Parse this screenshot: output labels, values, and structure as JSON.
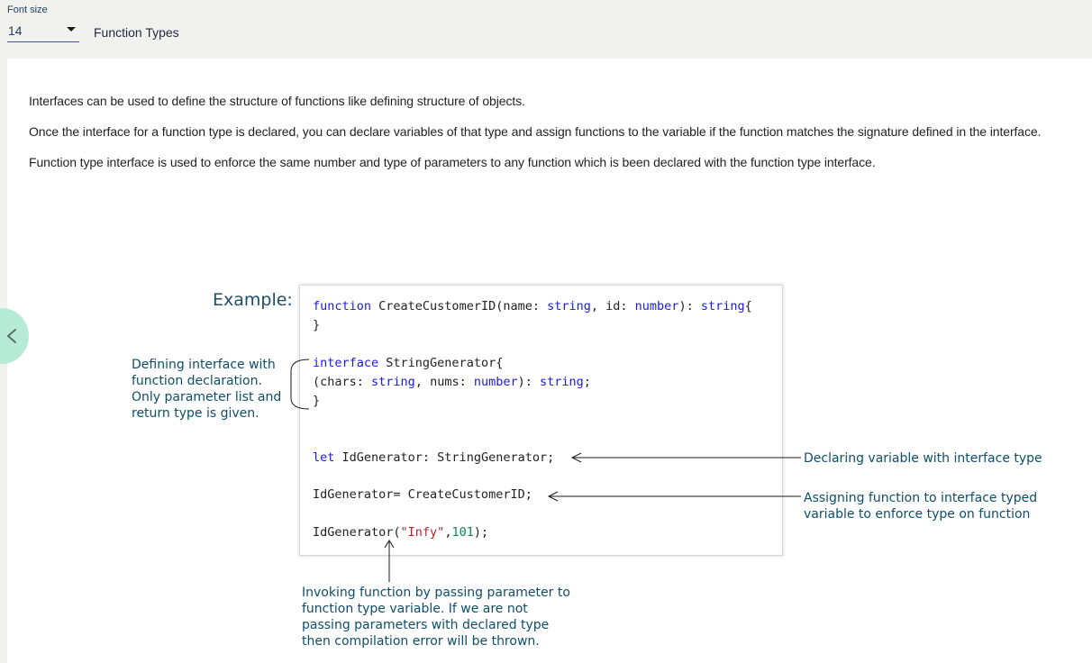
{
  "toolbar": {
    "font_size_label": "Font size",
    "font_size_value": "14",
    "title": "Function Types"
  },
  "content": {
    "paragraphs": [
      "Interfaces can be used to define the structure of functions like defining structure of objects.",
      "Once the interface for a function type is declared, you can declare variables of that type and assign functions to the variable if the function matches the signature defined in the interface.",
      "Function type interface is used to enforce the same number and type of parameters to any function which is been declared with the function type interface."
    ]
  },
  "figure": {
    "example_label": "Example:",
    "code": {
      "l1": {
        "kw1": "function",
        "t1": " CreateCustomerID(name: ",
        "kw2": "string",
        "t2": ", id: ",
        "kw3": "number",
        "t3": "): ",
        "kw4": "string",
        "t4": "{"
      },
      "l2": "}",
      "l3": {
        "kw1": "interface",
        "t1": " StringGenerator{"
      },
      "l4": {
        "t0": "(chars: ",
        "kw1": "string",
        "t1": ", nums: ",
        "kw2": "number",
        "t2": "): ",
        "kw3": "string",
        "t3": ";"
      },
      "l5": "}",
      "l6": {
        "kw1": "let",
        "t1": " IdGenerator: StringGenerator;"
      },
      "l7": "IdGenerator= CreateCustomerID;",
      "l8": {
        "t0": "IdGenerator(",
        "str": "\"Infy\"",
        "t1": ",",
        "num": "101",
        "t2": ");"
      }
    },
    "annotations": {
      "left": [
        "Defining interface with",
        "function declaration.",
        "Only parameter list and",
        "return type is given."
      ],
      "right_1": "Declaring variable with interface type",
      "right_2": [
        "Assigning function to interface typed",
        "variable to enforce type on function"
      ],
      "bottom": [
        "Invoking function by passing parameter to",
        "function type variable. If we are not",
        "passing parameters with declared type",
        "then compilation error will be thrown."
      ]
    }
  },
  "icons": {
    "back": "chevron-left-icon",
    "dropdown": "caret-down-icon"
  },
  "colors": {
    "accent_green": "#b6ecd6",
    "annotation": "#0e4e6a",
    "keyword": "#1a1ae0",
    "string": "#b0262b",
    "number": "#098658"
  }
}
